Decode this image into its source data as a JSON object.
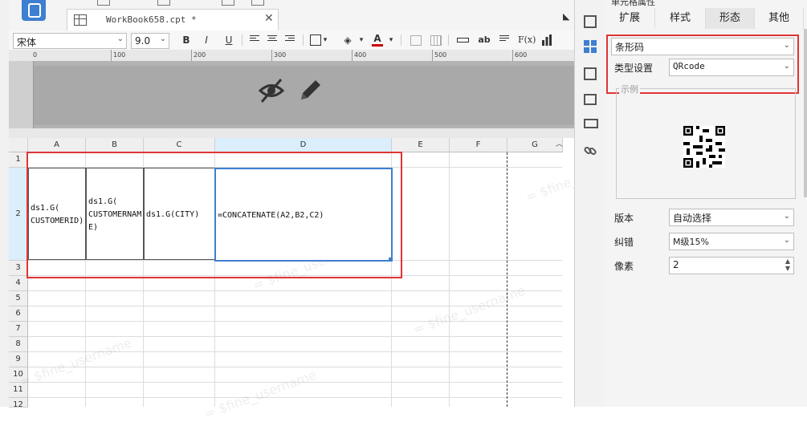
{
  "tab": {
    "title": "WorkBook658.cpt *",
    "close": "✕"
  },
  "toolbar": {
    "font_name": "宋体",
    "font_size": "9.0",
    "bold": "B",
    "italic": "I",
    "underline": "U",
    "label_ab": "ab",
    "label_fx": "F(x)"
  },
  "ruler": {
    "marks": [
      "100",
      "200",
      "300",
      "400",
      "500",
      "600"
    ]
  },
  "grid": {
    "columns": [
      "A",
      "B",
      "C",
      "D",
      "E",
      "F",
      "G"
    ],
    "rows": [
      "1",
      "2",
      "3",
      "4",
      "5",
      "6",
      "7",
      "8",
      "9",
      "10",
      "11",
      "12"
    ],
    "cells": {
      "A2": "ds1.G(\nCUSTOMERID)",
      "B2": "ds1.G(\nCUSTOMERNAM\nE)",
      "C2": "ds1.G(CITY)",
      "D2": "=CONCATENATE(A2,B2,C2)"
    },
    "watermark": "= $fine_username"
  },
  "panel": {
    "title": "单元格属性",
    "tabs": [
      "扩展",
      "样式",
      "形态",
      "其他"
    ],
    "active_tab": "形态",
    "form_type": "条形码",
    "type_label": "类型设置",
    "type_value": "QRcode",
    "example_legend": "示例",
    "version_label": "版本",
    "version_value": "自动选择",
    "error_label": "纠错",
    "error_value": "M级15%",
    "pixel_label": "像素",
    "pixel_value": "2"
  },
  "icons": {
    "sidebar": [
      "cell-element-icon",
      "cell-attribute-icon",
      "float-element-icon",
      "widget-icon",
      "condition-icon",
      "hyperlink-icon"
    ],
    "header_overlay": [
      "hide-icon",
      "edit-icon"
    ]
  },
  "colors": {
    "accent": "#3d7fd0",
    "highlight": "#e03434",
    "selection": "#dbeefc"
  }
}
